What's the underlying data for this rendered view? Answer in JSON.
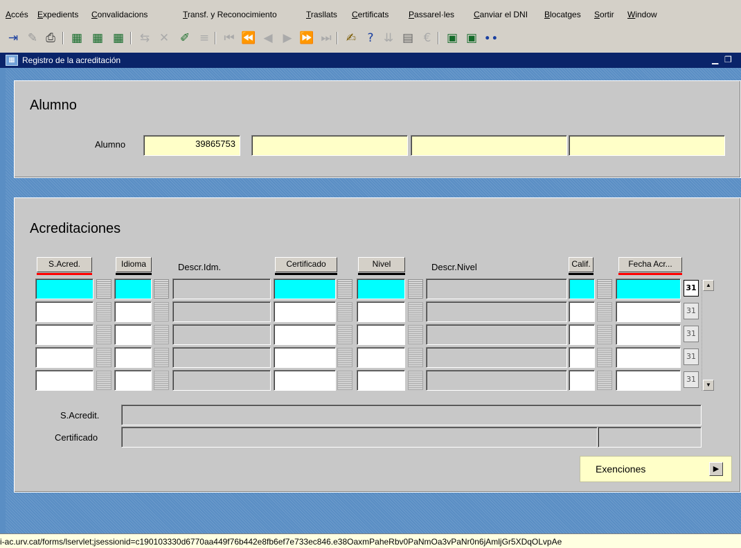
{
  "menu": [
    "Accés",
    "Expedients",
    "Convalidacions",
    "Transf. y Reconocimiento",
    "Trasllats",
    "Certificats",
    "Passarel·les",
    "Canviar el DNI",
    "Blocatges",
    "Sortir",
    "Window"
  ],
  "window": {
    "title": "Registro de la acreditación"
  },
  "alumno_section": {
    "title": "Alumno",
    "field_label": "Alumno",
    "value": "39865753"
  },
  "acreditaciones": {
    "title": "Acreditaciones",
    "columns": {
      "s_acred": "S.Acred.",
      "idioma": "Idioma",
      "descr_idm": "Descr.Idm.",
      "certificado": "Certificado",
      "nivel": "Nivel",
      "descr_nivel": "Descr.Nivel",
      "calif": "Calif.",
      "fecha_acr": "Fecha Acr..."
    },
    "calendar_glyph": "31",
    "detail_labels": {
      "s_acredit": "S.Acredit.",
      "certificado": "Certificado"
    },
    "exenciones_button": "Exenciones"
  },
  "status": {
    "url": "i-ac.urv.cat/forms/lservlet;jsessionid=c190103330d6770aa449f76b442e8fb6ef7e733ec846.e38OaxmPaheRbv0PaNmOa3vPaNr0n6jAmljGr5XDqOLvpAe"
  },
  "colors": {
    "required_field": "#00ffff",
    "query_field": "#ffffc8",
    "frame": "#5a8ec4",
    "title_bar": "#0a246a"
  }
}
